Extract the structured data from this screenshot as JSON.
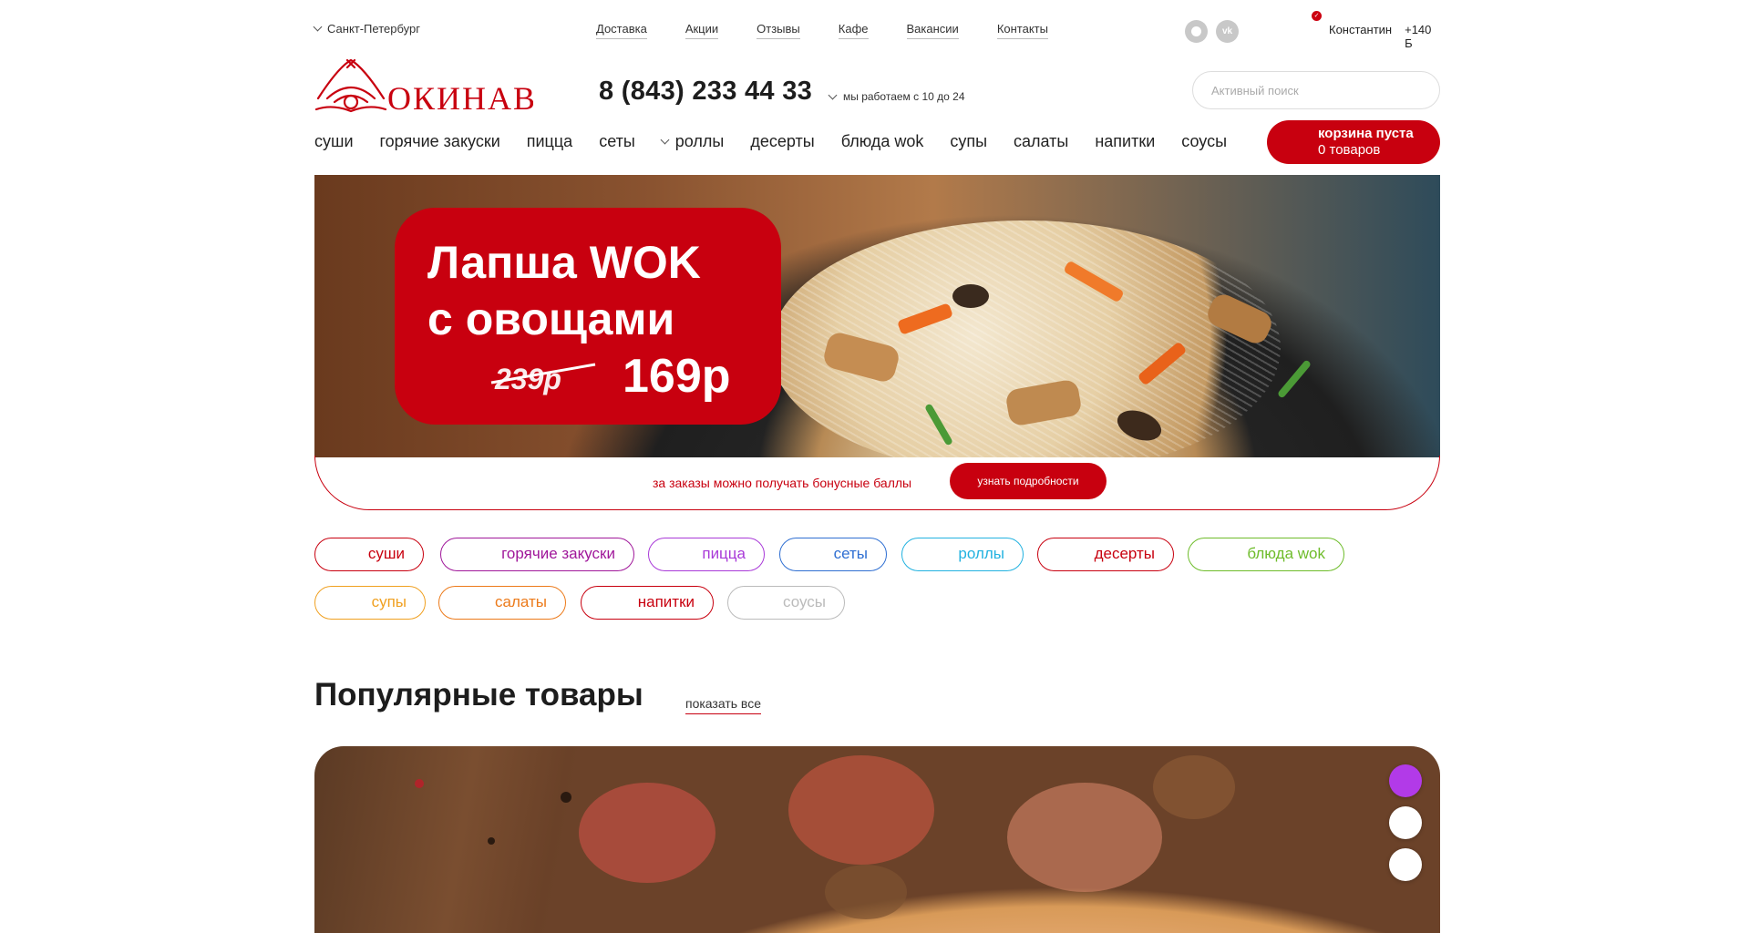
{
  "topbar": {
    "city": "Санкт-Петербург",
    "nav": [
      "Доставка",
      "Акции",
      "Отзывы",
      "Кафе",
      "Вакансии",
      "Контакты"
    ],
    "social": {
      "ok_icon": "odnoklassniki-icon",
      "vk_label": "vk"
    },
    "user_name": "Константин",
    "user_points": "+140 Б"
  },
  "header": {
    "logo_text": "ОКИНАВА",
    "phone": "8 (843) 233 44 33",
    "hours": "мы работаем с 10 до 24",
    "search_placeholder": "Активный поиск"
  },
  "mainnav": [
    "суши",
    "горячие закуски",
    "пицца",
    "сеты",
    "роллы",
    "десерты",
    "блюда wok",
    "супы",
    "салаты",
    "напитки",
    "соусы"
  ],
  "cart": {
    "line1": "корзина пуста",
    "line2": "0 товаров"
  },
  "banner": {
    "line1": "Лапша WOK",
    "line2": "с овощами",
    "old_price": "239р",
    "new_price": "169р"
  },
  "bonus": {
    "text": "за заказы можно получать бонусные баллы",
    "button": "узнать подробности"
  },
  "categories": [
    {
      "label": "суши",
      "color": "#c8000f"
    },
    {
      "label": "горячие закуски",
      "color": "#a0179a"
    },
    {
      "label": "пицца",
      "color": "#a93ad8"
    },
    {
      "label": "сеты",
      "color": "#2f6fd2"
    },
    {
      "label": "роллы",
      "color": "#22b2e0"
    },
    {
      "label": "десерты",
      "color": "#c8000f"
    },
    {
      "label": "блюда wok",
      "color": "#6ebc2a"
    },
    {
      "label": "супы",
      "color": "#f0a020"
    },
    {
      "label": "салаты",
      "color": "#ec7a1a"
    },
    {
      "label": "напитки",
      "color": "#c8000f"
    },
    {
      "label": "соусы",
      "color": "#bbbbbb"
    }
  ],
  "popular": {
    "title": "Популярные товары",
    "show_all": "показать все"
  },
  "colors": {
    "brand_red": "#c8000f",
    "dot_active": "#b23ae8"
  }
}
